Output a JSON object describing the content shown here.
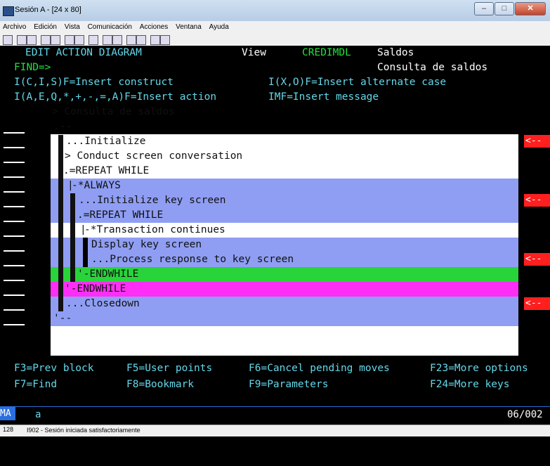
{
  "window": {
    "title": "Sesión A - [24 x 80]",
    "buttons": [
      "–",
      "□",
      "✕"
    ]
  },
  "menu": [
    "Archivo",
    "Edición",
    "Vista",
    "Comunicación",
    "Acciones",
    "Ventana",
    "Ayuda"
  ],
  "header": {
    "title": "EDIT ACTION DIAGRAM",
    "view": "View",
    "model": "CREDIMDL",
    "name": "Saldos",
    "find": "FIND=>",
    "subtitle": "Consulta de saldos",
    "help1a": "I(C,I,S)F=Insert construct",
    "help1b": "I(X,O)F=Insert alternate case",
    "help2a": "I(A,E,Q,*,+,-,=,A)F=Insert action",
    "help2b": "IMF=Insert message"
  },
  "diagram": {
    "root": "> Consulta de saldos",
    "lines": [
      "...Initialize",
      "> Conduct screen conversation",
      ".=REPEAT WHILE",
      "-*ALWAYS",
      "...Initialize key screen",
      ".=REPEAT WHILE",
      "-*Transaction continues",
      "Display key screen",
      "...Process response to key screen",
      "'-ENDWHILE",
      "'-ENDWHILE",
      "...Closedown"
    ],
    "marker": "<--"
  },
  "fkeys": {
    "f3": "F3=Prev block",
    "f5": "F5=User points",
    "f6": "F6=Cancel pending moves",
    "f23": "F23=More options",
    "f7": "F7=Find",
    "f8": "F8=Bookmark",
    "f9": "F9=Parameters",
    "f24": "F24=More keys"
  },
  "status": {
    "ma": "MA",
    "a": "a",
    "pos": "06/002",
    "bottom_num": "128",
    "bottom_msg": "I902 - Sesión iniciada satisfactoriamente"
  },
  "colors": {
    "green": "#21e23b",
    "pink": "#ff57ff",
    "blue_panel": "#8f9ef3",
    "red": "#ff1f1f"
  }
}
